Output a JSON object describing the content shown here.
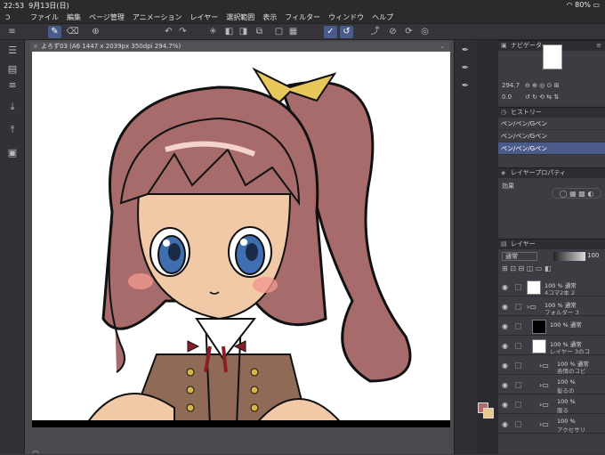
{
  "status": {
    "time": "22:53",
    "date": "9月13日(日)",
    "battery": "80%"
  },
  "menu": [
    "ファイル",
    "編集",
    "ページ管理",
    "アニメーション",
    "レイヤー",
    "選択範囲",
    "表示",
    "フィルター",
    "ウィンドウ",
    "ヘルプ"
  ],
  "document": {
    "tab": "よろず03 (A6 1447 x 2039px 350dpi 294.7%)"
  },
  "navigator": {
    "title": "ナビゲーター",
    "zoom": "294.7",
    "rotate": "0.0"
  },
  "history": {
    "title": "ヒストリー",
    "items": [
      "ペン/ペン/Gペン",
      "ペン/ペン/Gペン",
      "ペン/ペン/Gペン"
    ]
  },
  "layer_property": {
    "title": "レイヤープロパティ",
    "effect_label": "効果"
  },
  "layers": {
    "title": "レイヤー",
    "blend": "通常",
    "opacity": "100",
    "rows": [
      {
        "pct": "100 %",
        "mode": "通常",
        "name": "4コマ2本 2"
      },
      {
        "pct": "100 %",
        "mode": "通常",
        "name": "フォルダー 3"
      },
      {
        "pct": "100 %",
        "mode": "通常",
        "name": ""
      },
      {
        "pct": "100 %",
        "mode": "通常",
        "name": "レイヤー 3のコ"
      },
      {
        "pct": "100 %",
        "mode": "通常",
        "name": "表情のコピ"
      },
      {
        "pct": "100 %",
        "mode": "",
        "name": "髪るの"
      },
      {
        "pct": "100 %",
        "mode": "",
        "name": "服る"
      },
      {
        "pct": "100 %",
        "mode": "",
        "name": "アクセサリ"
      }
    ]
  }
}
